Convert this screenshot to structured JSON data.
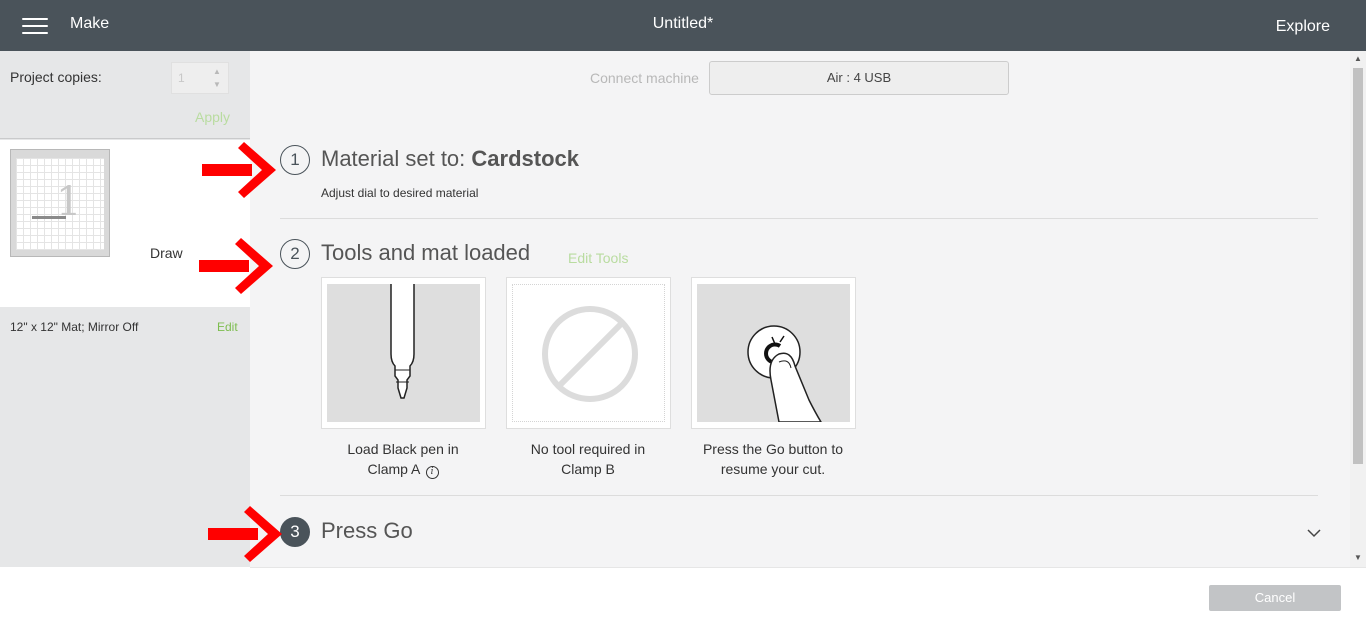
{
  "header": {
    "menu_icon": "hamburger-menu-icon",
    "section": "Make",
    "title": "Untitled*",
    "explore": "Explore"
  },
  "sidebar": {
    "copies_label": "Project copies:",
    "copies_value": "1",
    "stepper_up": "▲",
    "stepper_down": "▼",
    "apply": "Apply",
    "mat": {
      "operation": "Draw",
      "caption": "12\" x 12\" Mat; Mirror Off",
      "edit": "Edit",
      "preview_digit": "1"
    }
  },
  "main": {
    "connect_label": "Connect machine",
    "machine": "Air : 4 USB",
    "steps": [
      {
        "number": "1",
        "title_prefix": "Material set to: ",
        "title_value": "Cardstock",
        "subtitle": "Adjust dial to desired material"
      },
      {
        "number": "2",
        "title": "Tools and mat loaded",
        "edit_tools": "Edit Tools"
      },
      {
        "number": "3",
        "title": "Press Go"
      }
    ],
    "tools": [
      {
        "line1": "Load Black pen in",
        "line2": "Clamp A",
        "info_icon": "i",
        "image": "pen-icon"
      },
      {
        "line1": "No tool required in",
        "line2": "Clamp B",
        "image": "no-tool-icon"
      },
      {
        "line1": "Press the Go button to",
        "line2": "resume your cut.",
        "image": "press-go-icon"
      }
    ]
  },
  "scrollbar": {
    "up": "▲",
    "down": "▼"
  },
  "footer": {
    "cancel": "Cancel"
  },
  "colors": {
    "header_bg": "#4a535a",
    "sidebar_bg": "#e6e7e8",
    "main_bg": "#f4f4f5",
    "accent_green": "#7dbd4f",
    "annotation_red": "#ff0000",
    "cancel_bg": "#c2c4c6"
  }
}
